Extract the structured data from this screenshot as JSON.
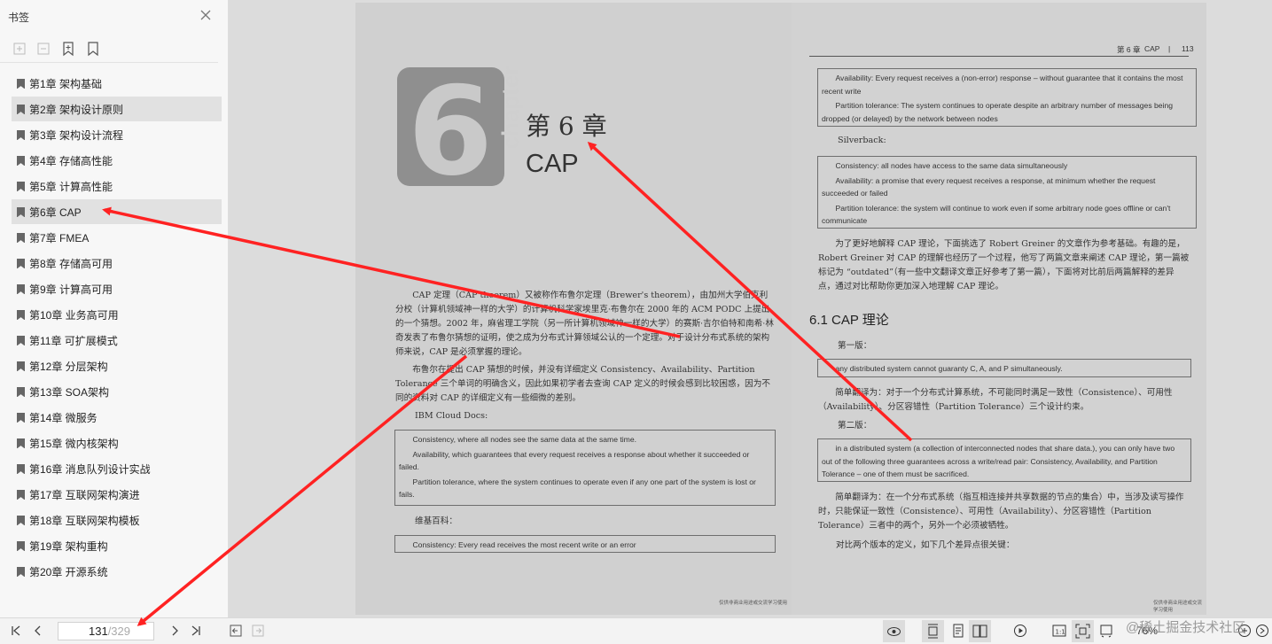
{
  "sidebar": {
    "title": "书签",
    "bookmarks": [
      {
        "label": "第1章 架构基础"
      },
      {
        "label": "第2章 架构设计原则"
      },
      {
        "label": "第3章 架构设计流程"
      },
      {
        "label": "第4章 存储高性能"
      },
      {
        "label": "第5章 计算高性能"
      },
      {
        "label": "第6章 CAP"
      },
      {
        "label": "第7章 FMEA"
      },
      {
        "label": "第8章 存储高可用"
      },
      {
        "label": "第9章 计算高可用"
      },
      {
        "label": "第10章 业务高可用"
      },
      {
        "label": "第11章 可扩展模式"
      },
      {
        "label": "第12章 分层架构"
      },
      {
        "label": "第13章 SOA架构"
      },
      {
        "label": "第14章 微服务"
      },
      {
        "label": "第15章 微内核架构"
      },
      {
        "label": "第16章 消息队列设计实战"
      },
      {
        "label": "第17章 互联网架构演进"
      },
      {
        "label": "第18章 互联网架构模板"
      },
      {
        "label": "第19章 架构重构"
      },
      {
        "label": "第20章 开源系统"
      }
    ],
    "selected_index": 5
  },
  "left_page": {
    "logo_number": "6",
    "logo_word": "chapter",
    "chapter_title": "第 6 章",
    "chapter_subtitle": "CAP",
    "para1": "CAP 定理（CAP theorem）又被称作布鲁尔定理（Brewer's theorem），由加州大学伯克利分校（计算机领域神一样的大学）的计算机科学家埃里克·布鲁尔在 2000 年的 ACM PODC 上提出的一个猜想。2002 年，麻省理工学院（另一所计算机领域神一样的大学）的赛斯·吉尔伯特和南希·林奇发表了布鲁尔猜想的证明，使之成为分布式计算领域公认的一个定理。对于设计分布式系统的架构师来说，CAP 是必须掌握的理论。",
    "para2": "布鲁尔在提出 CAP 猜想的时候，并没有详细定义 Consistency、Availability、Partition Tolerance 三个单词的明确含义，因此如果初学者去查询 CAP 定义的时候会感到比较困惑，因为不同的资料对 CAP 的详细定义有一些细微的差别。",
    "ibm_label": "IBM Cloud Docs:",
    "ibm_box": [
      "Consistency, where all nodes see the same data at the same time.",
      "Availability, which guarantees that every request receives a response about whether it succeeded or failed.",
      "Partition tolerance, where the system continues to operate even if any one part of the system is lost or fails."
    ],
    "wiki_label": "维基百科：",
    "wiki_box": "Consistency: Every read receives the most recent write or an error",
    "footer": "仅供非商业用途或交流学习使用"
  },
  "right_page": {
    "header_chapter": "第 6 章",
    "header_topic": "CAP",
    "header_sep": "|",
    "header_page": "113",
    "box1": [
      "Availability: Every request receives a (non-error) response – without guarantee that it contains the most recent write",
      "Partition tolerance: The system continues to operate despite an arbitrary number of messages being dropped (or delayed) by the network between nodes"
    ],
    "silverback_label": "Silverback:",
    "box2": [
      "Consistency: all nodes have access to the same data simultaneously",
      "Availability: a promise that every request receives a response, at minimum whether the request succeeded or failed",
      "Partition tolerance: the system will continue to work even if some arbitrary node goes offline or can't communicate"
    ],
    "para1": "为了更好地解释 CAP 理论，下面挑选了 Robert Greiner 的文章作为参考基础。有趣的是，Robert Greiner 对 CAP 的理解也经历了一个过程，他写了两篇文章来阐述 CAP 理论，第一篇被标记为 “outdated”（有一些中文翻译文章正好参考了第一篇），下面将对比前后两篇解释的差异点，通过对比帮助你更加深入地理解 CAP 理论。",
    "section": "6.1 CAP 理论",
    "v1_label": "第一版：",
    "v1_box": "any distributed system cannot guaranty C, A, and P simultaneously.",
    "v1_trans": "简单翻译为：对于一个分布式计算系统，不可能同时满足一致性（Consistence）、可用性（Availability）、分区容错性（Partition Tolerance）三个设计约束。",
    "v2_label": "第二版：",
    "v2_box": "in a distributed system (a collection of interconnected nodes that share data.), you can only have two out of the following three guarantees across a write/read pair: Consistency, Availability, and Partition Tolerance – one of them must be sacrificed.",
    "v2_trans": "简单翻译为：在一个分布式系统（指互相连接并共享数据的节点的集合）中，当涉及读写操作时，只能保证一致性（Consistence）、可用性（Availability）、分区容错性（Partition Tolerance）三者中的两个，另外一个必须被牺牲。",
    "compare": "对比两个版本的定义，如下几个差异点很关键：",
    "footer": "仅供非商业用途或交流学习使用"
  },
  "bottombar": {
    "current_page": "131",
    "total_pages": "/329",
    "zoom": "76%",
    "watermark": "@稀土掘金技术社区"
  },
  "colors": {
    "annotation_arrow": "#ff2222",
    "selected_bookmark": "#e1e1e1"
  }
}
